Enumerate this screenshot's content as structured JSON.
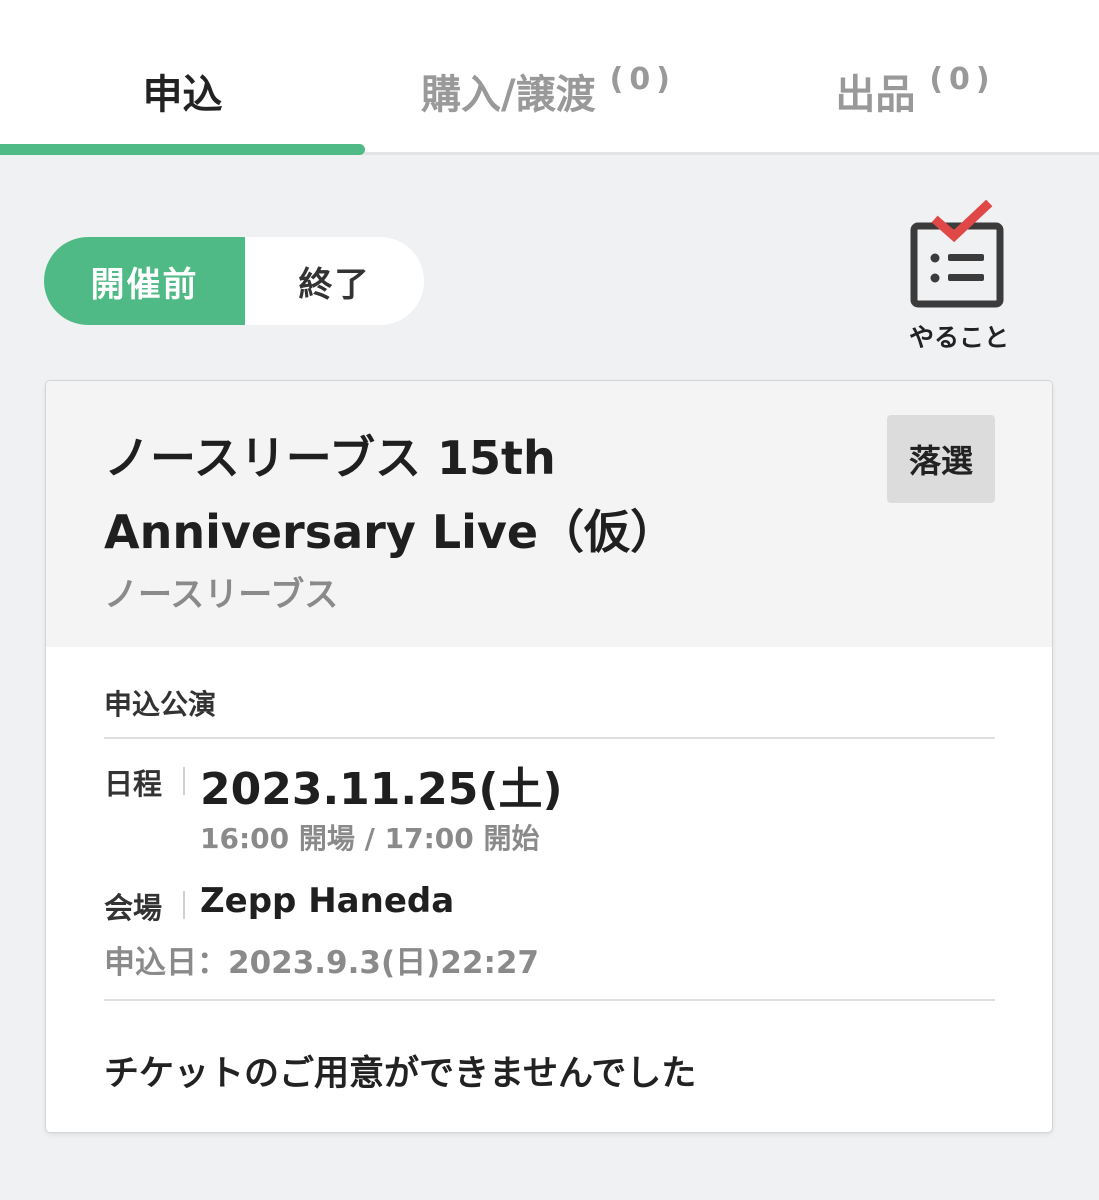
{
  "tabs": {
    "apply": {
      "label": "申込"
    },
    "buy": {
      "label": "購入/譲渡",
      "count": "(0)"
    },
    "sell": {
      "label": "出品",
      "count": "(0)"
    }
  },
  "filter": {
    "upcoming": "開催前",
    "ended": "終了"
  },
  "todo": {
    "label": "やること"
  },
  "event": {
    "title": "ノースリーブス 15th Anniversary Live（仮）",
    "artist": "ノースリーブス",
    "status": "落選",
    "section_label": "申込公演",
    "date_label": "日程",
    "date": "2023.11.25(土)",
    "times": "16:00 開場 / 17:00 開始",
    "venue_label": "会場",
    "venue": "Zepp Haneda",
    "applied": "申込日：2023.9.3(日)22:27",
    "result_message": "チケットのご用意ができませんでした"
  },
  "colors": {
    "accent": "#4fba85",
    "check": "#e04848",
    "muted": "#8a8a8a"
  }
}
